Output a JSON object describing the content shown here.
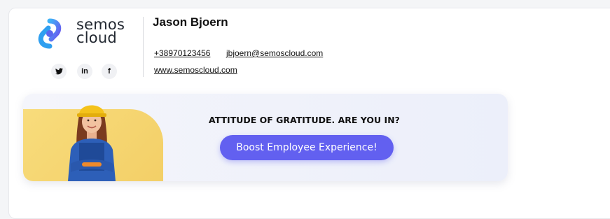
{
  "brand": {
    "line1": "semos",
    "line2": "cloud",
    "logo_icon": "semos-logo-icon",
    "logo_colors": [
      "#3ba7f5",
      "#6b52ef"
    ]
  },
  "socials": [
    {
      "label": "𝕪",
      "icon": "twitter-icon"
    },
    {
      "label": "in",
      "icon": "linkedin-icon"
    },
    {
      "label": "f",
      "icon": "facebook-icon"
    }
  ],
  "person": {
    "name": "Jason Bjoern"
  },
  "contact": {
    "phone": "+38970123456",
    "email": "jbjoern@semoscloud.com",
    "website": "www.semoscloud.com"
  },
  "banner": {
    "headline": "ATTITUDE OF GRATITUDE. ARE YOU IN?",
    "cta_label": "Boost Employee Experience!",
    "accent_color": "#6260f0",
    "blob_color": "#f5d36e"
  }
}
